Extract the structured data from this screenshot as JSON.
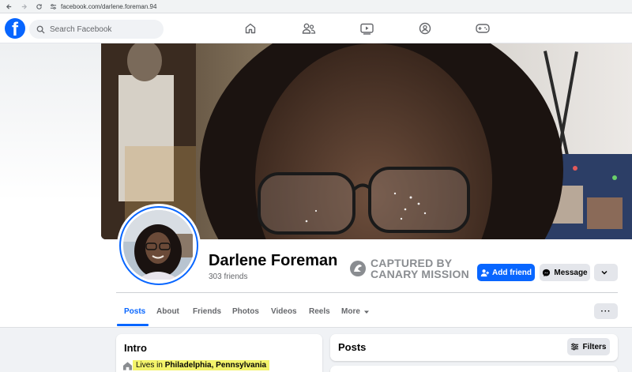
{
  "browser": {
    "url": "facebook.com/darlene.foreman.94"
  },
  "nav": {
    "logo_letter": "f",
    "search_placeholder": "Search Facebook"
  },
  "profile": {
    "name": "Darlene Foreman",
    "friends": "303 friends",
    "watermark_line1": "CAPTURED BY",
    "watermark_line2": "CANARY MISSION"
  },
  "actions": {
    "add_friend": "Add friend",
    "message": "Message"
  },
  "tabs": [
    {
      "label": "Posts"
    },
    {
      "label": "About"
    },
    {
      "label": "Friends"
    },
    {
      "label": "Photos"
    },
    {
      "label": "Videos"
    },
    {
      "label": "Reels"
    },
    {
      "label": "More"
    }
  ],
  "tabs_more_label": "···",
  "intro": {
    "title": "Intro",
    "lives_prefix": "Lives in",
    "location": "Philadelphia, Pennsylvania"
  },
  "posts": {
    "title": "Posts",
    "filters_label": "Filters"
  },
  "colors": {
    "brand": "#0866ff",
    "highlight": "#f3f36b"
  }
}
